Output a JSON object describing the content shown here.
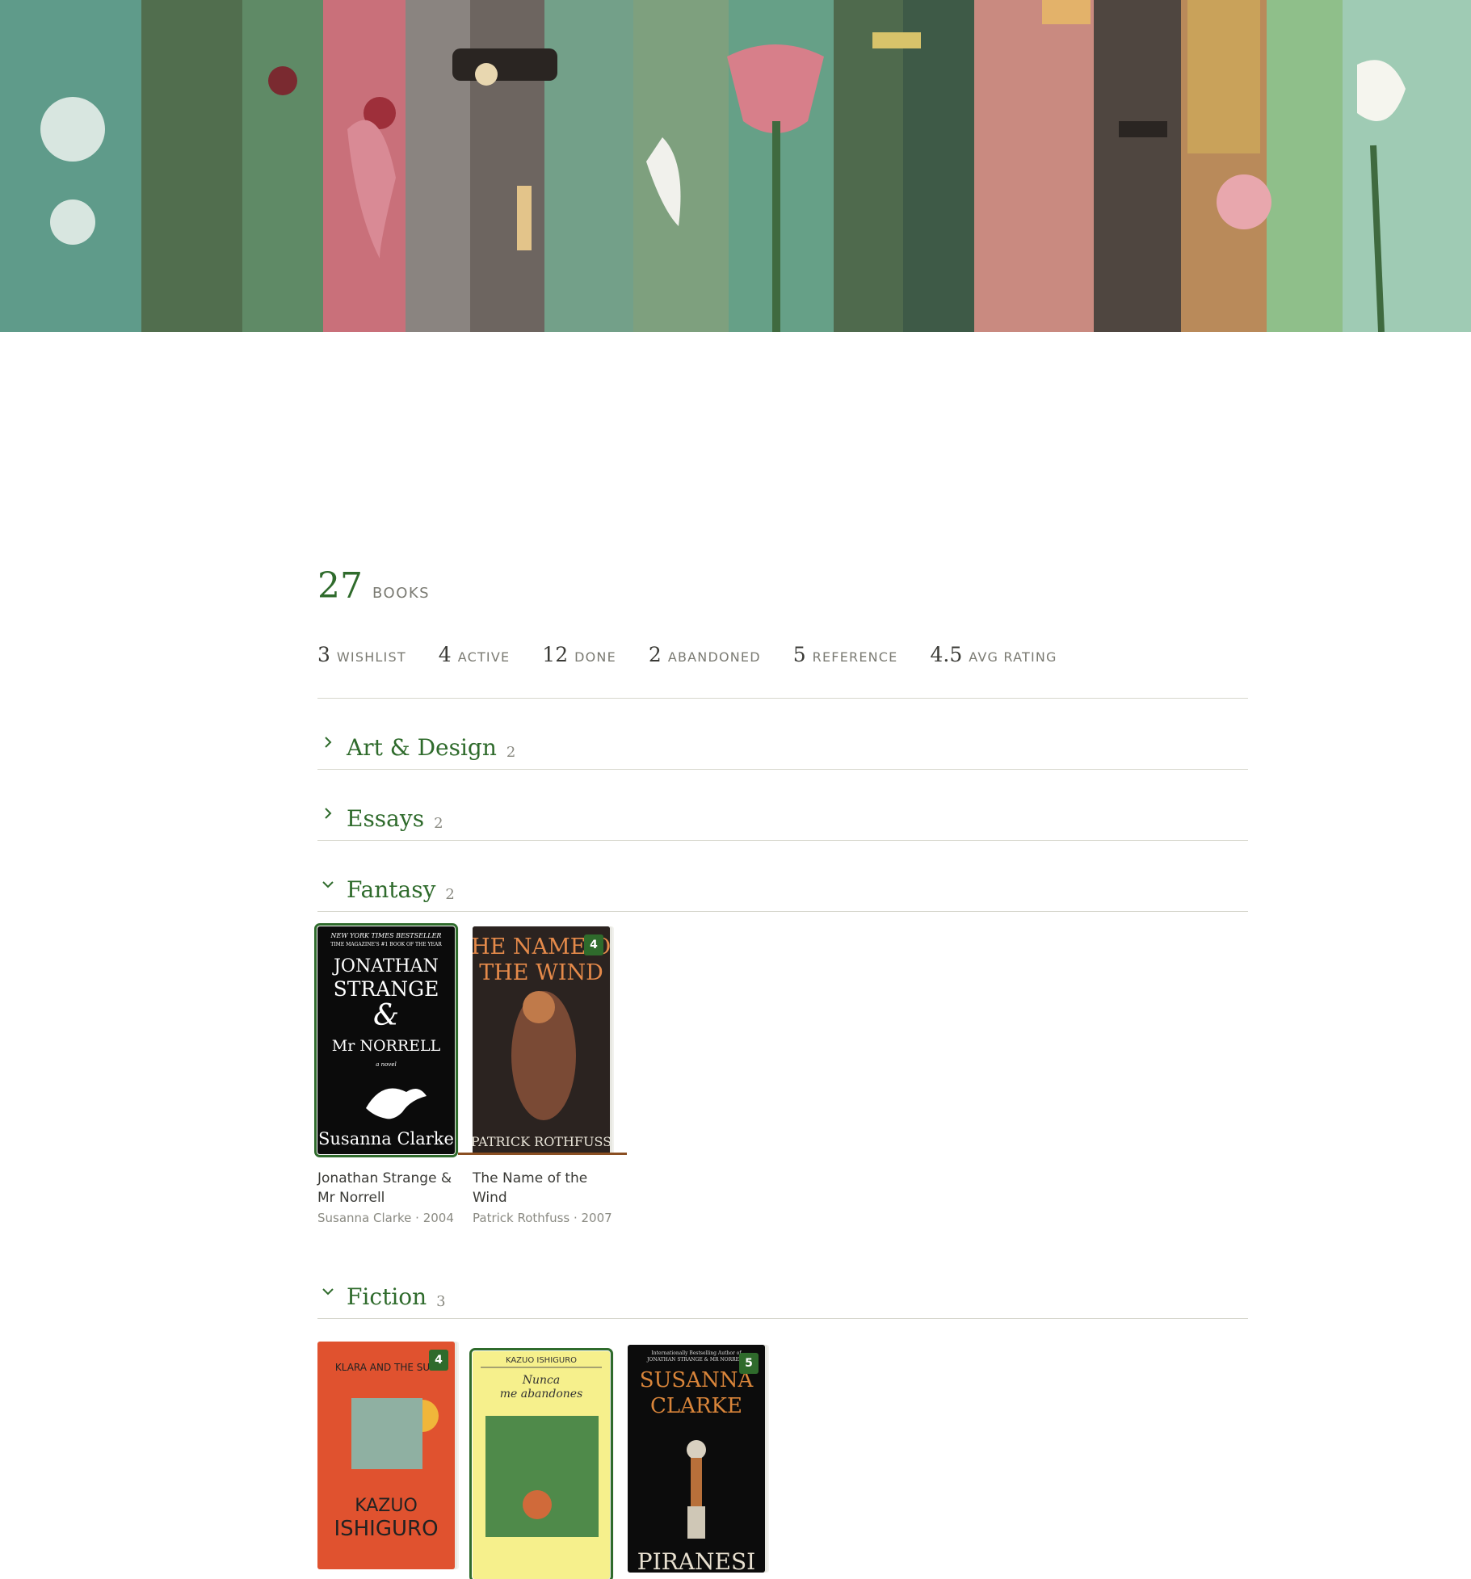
{
  "summary": {
    "total": "27",
    "total_label": "BOOKS"
  },
  "stats": [
    {
      "n": "3",
      "l": "WISHLIST"
    },
    {
      "n": "4",
      "l": "ACTIVE"
    },
    {
      "n": "12",
      "l": "DONE"
    },
    {
      "n": "2",
      "l": "ABANDONED"
    },
    {
      "n": "5",
      "l": "REFERENCE"
    },
    {
      "n": "4.5",
      "l": "AVG RATING"
    }
  ],
  "categories": [
    {
      "name": "Art & Design",
      "count": "2"
    },
    {
      "name": "Essays",
      "count": "2"
    },
    {
      "name": "Fantasy",
      "count": "2"
    },
    {
      "name": "Fiction",
      "count": "3"
    }
  ],
  "fantasy_books": [
    {
      "title": "Jonathan Strange & Mr Norrell",
      "meta": "Susanna Clarke · 2004",
      "cover": {
        "top": "NEW YORK TIMES BESTSELLER",
        "top2": "TIME MAGAZINE'S #1 BOOK OF THE YEAR",
        "l1": "JONATHAN",
        "l2": "STRANGE",
        "l3": "&",
        "l4": "Mr NORRELL",
        "sub": "a novel",
        "author": "Susanna Clarke"
      }
    },
    {
      "title": "The Name of the Wind",
      "meta": "Patrick Rothfuss · 2007",
      "rating": "4",
      "cover": {
        "l1": "THE NAME OF",
        "l2": "THE WIND",
        "author": "PATRICK ROTHFUSS"
      }
    }
  ],
  "fiction_books": [
    {
      "rating": "4",
      "cover": {
        "l1": "KLARA AND THE SUN",
        "author1": "KAZUO",
        "author2": "ISHIGURO"
      }
    },
    {
      "cover": {
        "author": "KAZUO ISHIGURO",
        "l1": "Nunca",
        "l2": "me abandones"
      }
    },
    {
      "rating": "5",
      "cover": {
        "top": "Internationally Bestselling Author of",
        "top2": "JONATHAN STRANGE & MR NORRELL",
        "author1": "SUSANNA",
        "author2": "CLARKE",
        "title": "PIRANESI"
      }
    }
  ],
  "colors": {
    "accent": "#2f6b2c",
    "muted": "#7a7a72",
    "rule": "#d6d6cc",
    "shelf": "#8a4f22"
  }
}
